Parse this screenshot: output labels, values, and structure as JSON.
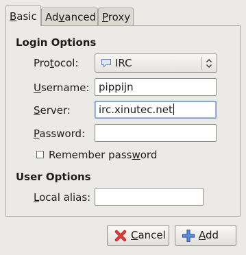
{
  "tabs": [
    {
      "mnemonic": "B",
      "rest": "asic",
      "active": true
    },
    {
      "pre": "Ad",
      "mnemonic": "v",
      "rest": "anced",
      "active": false
    },
    {
      "mnemonic": "P",
      "rest": "roxy",
      "active": false
    }
  ],
  "login_options": {
    "title": "Login Options",
    "protocol": {
      "label_pre": "Pro",
      "label_mnemonic": "t",
      "label_post": "ocol:",
      "value": "IRC",
      "icon": "chat-bubble-icon"
    },
    "username": {
      "label_mnemonic": "U",
      "label_post": "sername:",
      "value": "pippijn"
    },
    "server": {
      "label_mnemonic": "S",
      "label_post": "erver:",
      "value": "irc.xinutec.net"
    },
    "password": {
      "label_mnemonic": "P",
      "label_post": "assword:",
      "value": ""
    },
    "remember": {
      "label_pre": "Remember pass",
      "label_mnemonic": "w",
      "label_post": "ord",
      "checked": false
    }
  },
  "user_options": {
    "title": "User Options",
    "local_alias": {
      "label_mnemonic": "L",
      "label_post": "ocal alias:",
      "value": ""
    }
  },
  "buttons": {
    "cancel": {
      "mnemonic": "C",
      "rest": "ancel",
      "icon": "red-x-icon"
    },
    "add": {
      "mnemonic": "A",
      "rest": "dd",
      "icon": "blue-plus-icon"
    }
  },
  "colors": {
    "window_bg": "#eceae6",
    "focus_border": "#6a8fc7",
    "cancel_icon": "#cc2222",
    "add_icon": "#3f6fc4"
  }
}
